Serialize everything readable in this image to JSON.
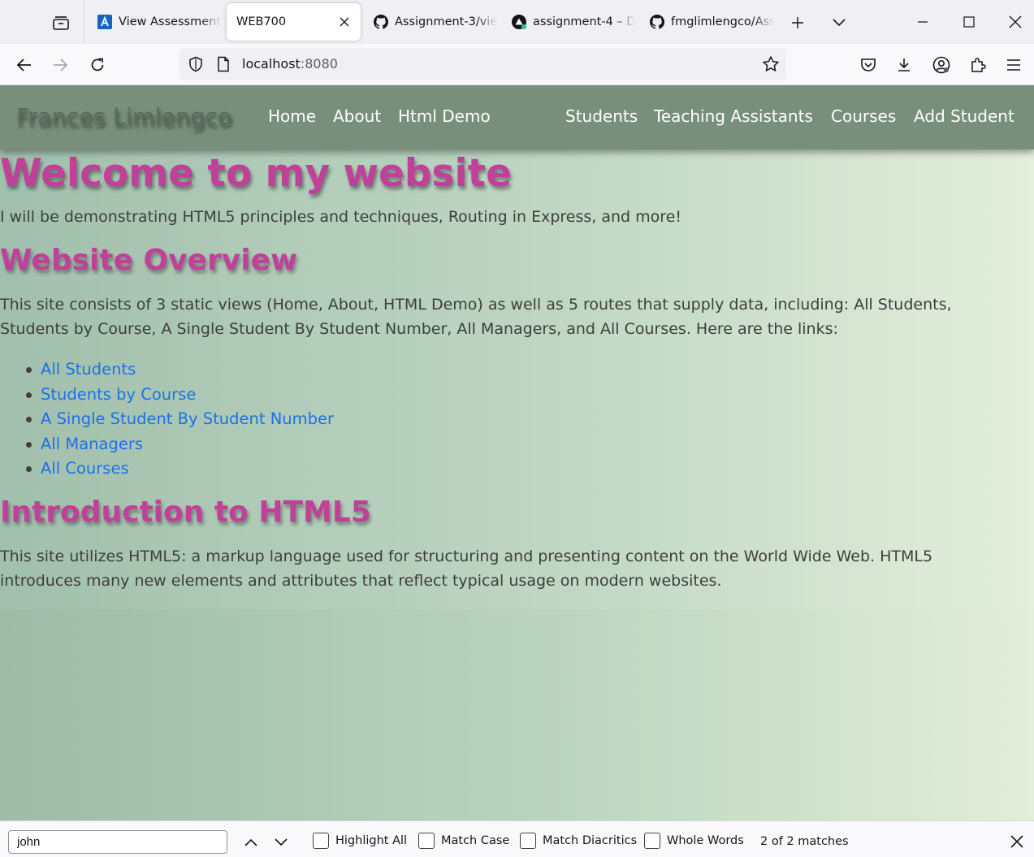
{
  "browser": {
    "tabs": [
      {
        "title": "View Assessment",
        "icon": "assessment-favicon"
      },
      {
        "title": "WEB700",
        "icon": "none",
        "active": true
      },
      {
        "title": "Assignment-3/vie",
        "icon": "github-icon"
      },
      {
        "title": "assignment-4 – D",
        "icon": "vercel-icon"
      },
      {
        "title": "fmglimlengco/Ass",
        "icon": "github-icon"
      }
    ],
    "url_host": "localhost",
    "url_port": ":8080"
  },
  "site": {
    "brand": "Frances Limlengco",
    "nav_left": [
      "Home",
      "About",
      "Html Demo"
    ],
    "nav_right": [
      "Students",
      "Teaching Assistants",
      "Courses",
      "Add Student"
    ]
  },
  "content": {
    "welcome_heading": "Welcome to my website",
    "welcome_text": "I will be demonstrating HTML5 principles and techniques, Routing in Express, and more!",
    "overview_heading": "Website Overview",
    "overview_text": "This site consists of 3 static views (Home, About, HTML Demo) as well as 5 routes that supply data, including: All Students, Students by Course, A Single Student By Student Number, All Managers, and All Courses. Here are the links:",
    "links": [
      "All Students",
      "Students by Course",
      "A Single Student By Student Number",
      "All Managers",
      "All Courses"
    ],
    "intro_heading": "Introduction to HTML5",
    "intro_text": "This site utilizes HTML5: a markup language used for structuring and presenting content on the World Wide Web. HTML5 introduces many new elements and attributes that reflect typical usage on modern websites."
  },
  "findbar": {
    "query": "john",
    "options": [
      "Highlight All",
      "Match Case",
      "Match Diacritics",
      "Whole Words"
    ],
    "status": "2 of 2 matches"
  },
  "colors": {
    "heading": "#c0409a",
    "link": "#1a72e8",
    "header_bg": "#778f7b"
  }
}
